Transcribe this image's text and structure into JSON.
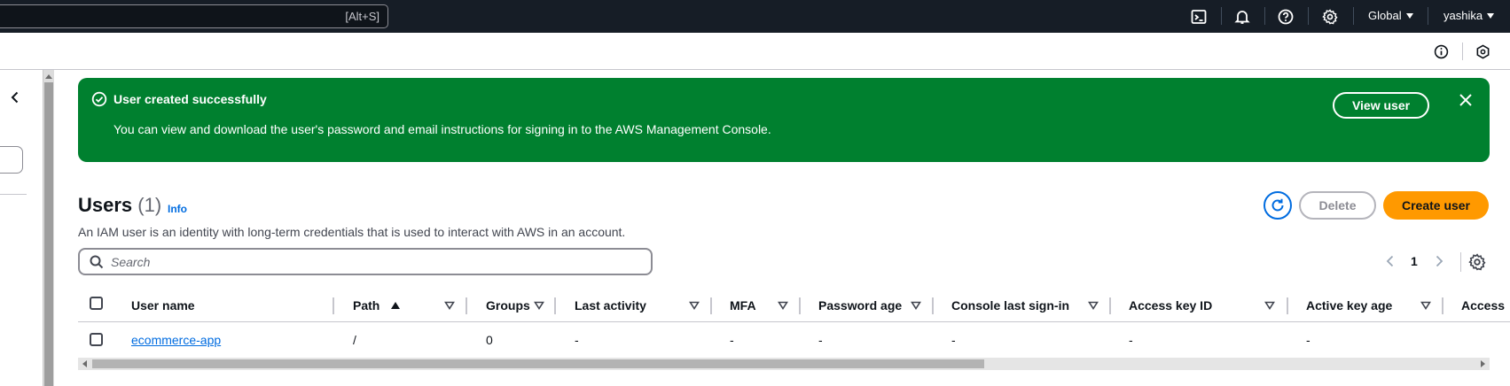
{
  "topbar": {
    "search_shortcut": "[Alt+S]",
    "region_label": "Global",
    "account_label": "yashika",
    "icons": [
      "cloudshell-icon",
      "bell-icon",
      "help-icon",
      "settings-icon"
    ]
  },
  "flash": {
    "header": "User created successfully",
    "body": "You can view and download the user's password and email instructions for signing in to the AWS Management Console.",
    "action_label": "View user",
    "color": "#00802f"
  },
  "header": {
    "title": "Users",
    "count": "(1)",
    "info_link": "Info",
    "description": "An IAM user is an identity with long-term credentials that is used to interact with AWS in an account.",
    "delete_label": "Delete",
    "create_label": "Create user",
    "accent_color": "#ff9900",
    "link_color": "#006ce0"
  },
  "search": {
    "placeholder": "Search",
    "value": ""
  },
  "pagination": {
    "current_page": "1"
  },
  "table": {
    "columns": [
      "User name",
      "Path",
      "Groups",
      "Last activity",
      "MFA",
      "Password age",
      "Console last sign-in",
      "Access key ID",
      "Active key age",
      "Access"
    ],
    "rows": [
      {
        "user_name": "ecommerce-app",
        "path": "/",
        "groups": "0",
        "last_activity": "-",
        "mfa": "-",
        "password_age": "-",
        "console_last_sign_in": "-",
        "access_key_id": "-",
        "active_key_age": "-"
      }
    ]
  }
}
